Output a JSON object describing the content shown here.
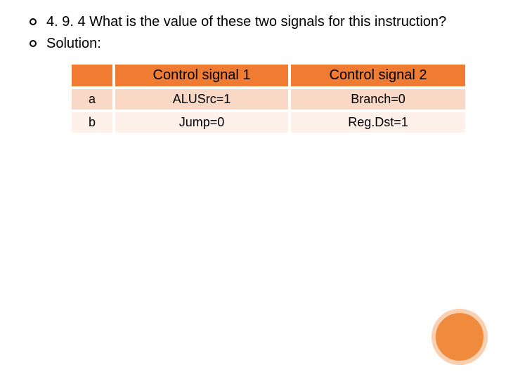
{
  "bullets": {
    "q": "4. 9. 4  What is the value of these two signals for this instruction?",
    "sol": "Solution:"
  },
  "table": {
    "headers": {
      "c1": "Control signal 1",
      "c2": "Control signal 2"
    },
    "rows": [
      {
        "label": "a",
        "c1": "ALUSrc=1",
        "c2": "Branch=0"
      },
      {
        "label": "b",
        "c1": "Jump=0",
        "c2": "Reg.Dst=1"
      }
    ]
  }
}
